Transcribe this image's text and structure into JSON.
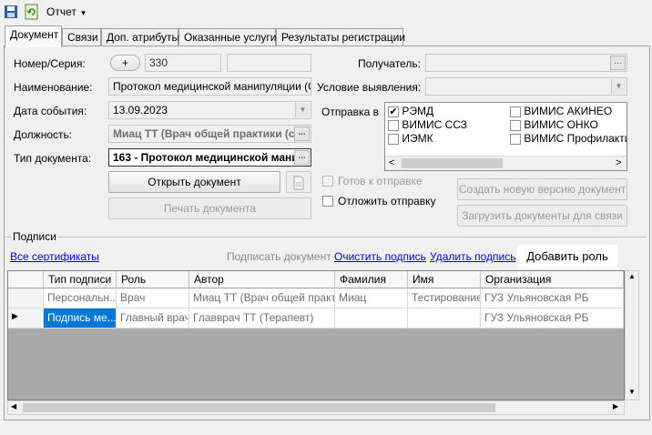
{
  "toolbar": {
    "report_label": "Отчет",
    "report_arrow": "▾"
  },
  "tabs": [
    {
      "label": "Документ"
    },
    {
      "label": "Связи"
    },
    {
      "label": "Доп. атрибуты"
    },
    {
      "label": "Оказанные услуги"
    },
    {
      "label": "Результаты регистрации"
    }
  ],
  "form": {
    "number_label": "Номер/Серия:",
    "plus_label": "+",
    "number_value": "330",
    "series_value": "",
    "name_label": "Наименование:",
    "name_value": "Протокол медицинской манипуляции (CDA",
    "event_date_label": "Дата события:",
    "event_date_value": "13.09.2023",
    "position_label": "Должность:",
    "position_value": "Миац ТТ (Врач общей практики (с",
    "doctype_label": "Тип документа:",
    "doctype_value": "163 - Протокол медицинской мани",
    "recipient_label": "Получатель:",
    "recipient_value": "",
    "condition_label": "Условие выявления:",
    "condition_value": "",
    "send_label": "Отправка в"
  },
  "send_targets": {
    "left": [
      {
        "label": "РЭМД",
        "checked": "✔"
      },
      {
        "label": "ВИМИС ССЗ",
        "checked": ""
      },
      {
        "label": "ИЭМК",
        "checked": ""
      }
    ],
    "right": [
      {
        "label": "ВИМИС АКИНЕО",
        "checked": ""
      },
      {
        "label": "ВИМИС ОНКО",
        "checked": ""
      },
      {
        "label": "ВИМИС Профилактика",
        "checked": ""
      }
    ]
  },
  "buttons": {
    "open_document": "Открыть документ",
    "print_document": "Печать документа",
    "create_version": "Создать новую версию документ",
    "load_documents": "Загрузить документы для связи",
    "add_role": "Добавить роль"
  },
  "checks": {
    "ready_label": "Готов к отправке",
    "defer_label": "Отложить отправку"
  },
  "signatures": {
    "group_label": "Подписи",
    "all_certs": "Все сертификаты",
    "sign_document": "Подписать документ",
    "clear_signature": "Очистить подпись",
    "delete_signature": "Удалить подпись"
  },
  "table": {
    "columns": [
      "Тип подписи",
      "Роль",
      "Автор",
      "Фамилия",
      "Имя",
      "Организация"
    ],
    "rows": [
      [
        "Персональн...",
        "Врач",
        "Миац ТТ (Врач общей практ...",
        "Миац",
        "Тестирование",
        "ГУЗ Ульяновская РБ"
      ],
      [
        "Подпись ме...",
        "Главный врач",
        "Главврач ТТ (Терапевт)",
        "",
        "",
        "ГУЗ Ульяновская РБ"
      ]
    ],
    "current_row_marker": "▶"
  },
  "colors": {
    "accent": "#0078d7",
    "link": "#0000ee",
    "grid_bg": "#a9a9a9"
  },
  "icons": [
    "save-icon",
    "refresh-icon",
    "chevron-down-icon",
    "ellipsis-icon",
    "document-icon"
  ]
}
